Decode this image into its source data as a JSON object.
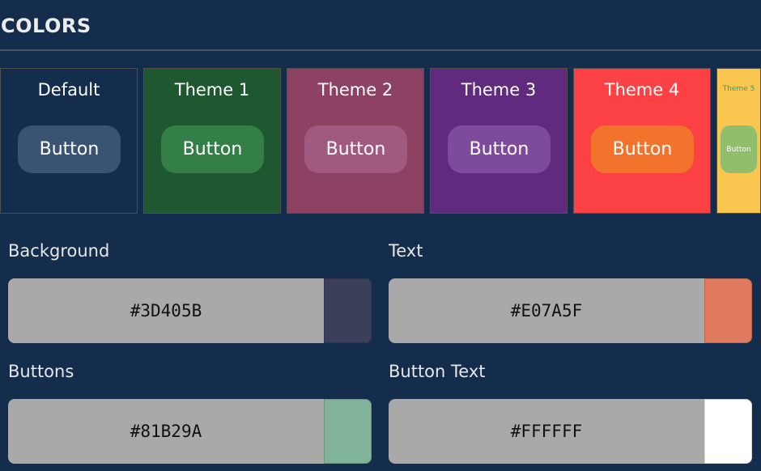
{
  "title": "COLORS",
  "themes": [
    {
      "name": "Default",
      "button": "Button",
      "bg": "#142d4c",
      "button_bg": "#3a5372",
      "text": "#ffffff"
    },
    {
      "name": "Theme 1",
      "button": "Button",
      "bg": "#1f5730",
      "button_bg": "#337f47",
      "text": "#ffffff"
    },
    {
      "name": "Theme 2",
      "button": "Button",
      "bg": "#8d4263",
      "button_bg": "#a05a7f",
      "text": "#ffffff"
    },
    {
      "name": "Theme 3",
      "button": "Button",
      "bg": "#602a7e",
      "button_bg": "#7e4a9b",
      "text": "#ffffff"
    },
    {
      "name": "Theme 4",
      "button": "Button",
      "bg": "#fb4143",
      "button_bg": "#f3722c",
      "text": "#ffffff"
    },
    {
      "name": "Theme 5",
      "button": "Button",
      "bg": "#f9c74f",
      "button_bg": "#90be6d",
      "text": "#2a9d8f"
    }
  ],
  "colors": [
    {
      "label": "Background",
      "hex": "#3D405B",
      "swatch": "#3b3f59"
    },
    {
      "label": "Text",
      "hex": "#E07A5F",
      "swatch": "#e07a5f"
    },
    {
      "label": "Buttons",
      "hex": "#81B29A",
      "swatch": "#81b29a"
    },
    {
      "label": "Button Text",
      "hex": "#FFFFFF",
      "swatch": "#ffffff"
    }
  ]
}
